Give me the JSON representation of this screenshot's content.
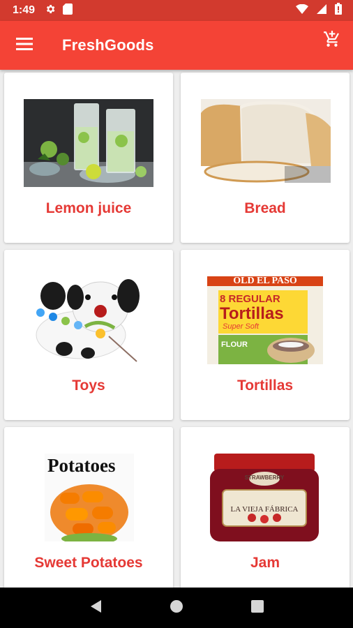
{
  "status_bar": {
    "time": "1:49",
    "icons": [
      "settings-icon",
      "sd-card-icon",
      "wifi-icon",
      "signal-icon",
      "battery-icon"
    ]
  },
  "app_bar": {
    "title": "FreshGoods",
    "menu_icon": "menu-icon",
    "cart_icon": "add-shopping-cart-icon",
    "color": "#f44336"
  },
  "products": [
    {
      "name": "Lemon juice"
    },
    {
      "name": "Bread"
    },
    {
      "name": "Toys"
    },
    {
      "name": "Tortillas"
    },
    {
      "name": "Sweet Potatoes"
    },
    {
      "name": "Jam"
    }
  ],
  "product_images": {
    "tortillas_brand": "OLD EL PASO",
    "tortillas_count": "8 REGULAR",
    "tortillas_title": "Tortillas",
    "tortillas_sub": "Super Soft",
    "tortillas_flour": "FLOUR",
    "potatoes_text": "Potatoes",
    "jam_flavor": "STRAWBERRY",
    "jam_brand": "LA VIEJA FÁBRICA"
  },
  "nav_bar": {
    "buttons": [
      "back-icon",
      "home-icon",
      "recents-icon"
    ]
  },
  "colors": {
    "accent": "#f44336",
    "status_bar": "#d23a2e",
    "label": "#e53935"
  }
}
